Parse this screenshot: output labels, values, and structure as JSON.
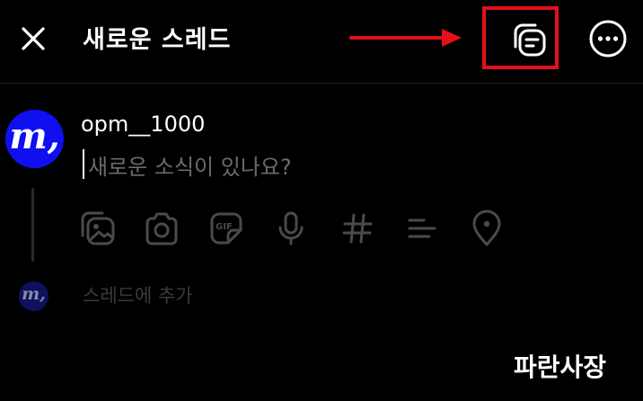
{
  "header": {
    "title": "새로운 스레드",
    "close_icon": "close-icon",
    "drafts_icon": "drafts-icon",
    "more_icon": "more-options-icon"
  },
  "annotation": {
    "arrow_color": "#e3101a",
    "box_color": "#e3101a"
  },
  "composer": {
    "username": "opm__1000",
    "placeholder": "새로운 소식이 있나요?",
    "avatar_letter": "m,",
    "avatar_color": "#0f0ff0",
    "tools": [
      "image-gallery-icon",
      "camera-icon",
      "gif-icon",
      "microphone-icon",
      "hashtag-icon",
      "list-icon",
      "location-icon"
    ]
  },
  "add_thread": {
    "label": "스레드에 추가",
    "avatar_letter": "m,"
  },
  "watermark": {
    "text": "파란사장"
  }
}
